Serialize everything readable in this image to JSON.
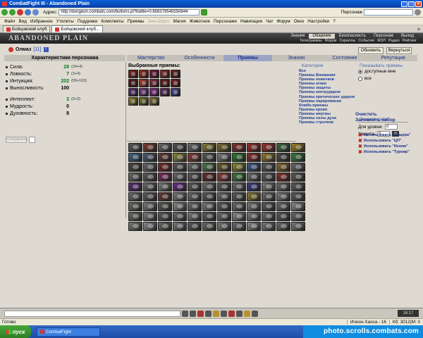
{
  "window": {
    "title": "CombatFight III - Abandoned Plain"
  },
  "address": {
    "label": "Адрес:",
    "url": "http://dungeon.combats.com/buttons.pl?battle=0.658379545550844",
    "search_label": "Персонаж"
  },
  "menu": [
    "Файл",
    "Вид",
    "Избранное",
    "Утилиты",
    "Поддинки",
    "Комплекты",
    "Приемы",
    "Зим.Шфос",
    "Магия",
    "Животное",
    "Персонажи",
    "Навигация",
    "Чат",
    "Форум",
    "Окно",
    "Настройки",
    "?"
  ],
  "tabs": [
    "Бойцовский клуб",
    "Бойцовский клуб..."
  ],
  "game": {
    "logo": "ABANDONED PLAIN",
    "topnav": [
      "Знания",
      "Общение",
      "Безопасность",
      "Персонаж",
      "Выход"
    ],
    "topnav_active": "Общение",
    "subnav": [
      "Телеграммы",
      "Форум",
      "Скриллы",
      "События",
      "ЖЗЛ",
      "Радио",
      "Рейтинг"
    ],
    "character": {
      "name": "Олмаз",
      "level": "[11]",
      "info": "i"
    },
    "buttons": {
      "refresh": "Обновить",
      "back": "Вернуться"
    },
    "char_header": "Характеристики персонажа",
    "section_tabs": [
      "Мастерство",
      "Особенности",
      "Приемы",
      "Знания",
      "Состояние",
      "Репутация"
    ],
    "section_active": "Приемы",
    "stats": [
      {
        "label": "Сила:",
        "value": "28",
        "bonus": "(24+4)",
        "green": true
      },
      {
        "label": "Ловкость:",
        "value": "7",
        "bonus": "(3+4)",
        "green": true
      },
      {
        "label": "Интуиция:",
        "value": "202",
        "bonus": "(99+103)",
        "green": true
      },
      {
        "label": "Выносливость:",
        "value": "100",
        "bonus": "",
        "green": false
      }
    ],
    "stats2": [
      {
        "label": "Интеллект:",
        "value": "3",
        "bonus": "(0+3)",
        "green": true
      },
      {
        "label": "Мудрость:",
        "value": "0",
        "bonus": "",
        "green": false
      },
      {
        "label": "Духовность:",
        "value": "8",
        "bonus": "",
        "green": false
      }
    ],
    "save_label": "Сохранить",
    "selected_title": "Выбранные приемы:",
    "categories_title": "Категории",
    "categories": [
      "Все",
      "Приемы Внимания",
      "Приемы новичков",
      "Приемы атаки",
      "Приемы защиты",
      "Приемы контрударов",
      "Приемы критических ударов",
      "Приемы парирования",
      "Комбо-приемы",
      "Приемы крови",
      "Приемы жертвы",
      "Приемы силы духа",
      "Приемы стрелков"
    ],
    "show_title": "Показывать приемы",
    "show_options": [
      "доступные мне",
      "все"
    ],
    "protect_title": "Защита цели",
    "for_level_label": "Для уровня:",
    "for_level_value": "0",
    "protect_label": "Защита:",
    "protect_value": "0",
    "ok_label": "ok",
    "clear_label": "Очистить",
    "remember_label": "Запомнить набор",
    "use_sets": [
      "Использовать \"Пещера\"",
      "Использовать \"ЦП\"",
      "Использовать \"Излом\"",
      "Использовать \"Турнир\""
    ],
    "clock": "16:17"
  },
  "status": {
    "ready": "Готово",
    "user": "Илион Хаоса - 16",
    "net": "Кб: 3012(М: 0"
  },
  "taskbar": {
    "start": "пуск",
    "task": "CombatFight"
  },
  "watermark": "photo.scrolls.combats.com",
  "colors": {
    "banner": "#2c2c2c",
    "active_tab": "#9ca6c4",
    "link": "#1b2e8a"
  },
  "selected_icons": [
    "#8a1f1f",
    "#a3301a",
    "#7a1a3a",
    "#9a2a2a",
    "#6e2424",
    "#5b1b1b",
    "#b33a2a",
    "#8e2b40",
    "#6a1a1a",
    "#7d2020",
    "#5f2a7a",
    "#7a3a8a",
    "#8a3090",
    "#6a2a6a",
    "#4a4a9a",
    "#9a8a2a",
    "#7a7a2a",
    "#8a7a3a"
  ],
  "all_icons": [
    "#5a5a5a",
    "#7a3a2a",
    "#6a6a6a",
    "#555555",
    "#6b6b6b",
    "#8a7a2a",
    "#7a6a2a",
    "#8a2a2a",
    "#9a2a2a",
    "#a0302a",
    "#3a6a3a",
    "#a08020",
    "#3a6a8a",
    "#4a5a6a",
    "#6a3a3a",
    "#8a8a3a",
    "#8a3a3a",
    "#5a5a5a",
    "#7a7a7a",
    "#2a7a2a",
    "#8a2a2a",
    "#9a7a2a",
    "#4a4a4a",
    "#3a7a3a",
    "#4a4a4a",
    "#6a6a6a",
    "#7a2a2a",
    "#5a5a5a",
    "#6a6a6a",
    "#4a7a4a",
    "#6a5a2a",
    "#8a8a2a",
    "#3a5a8a",
    "#5a5a5a",
    "#8a6a2a",
    "#6a6a6a",
    "#6a6a6a",
    "#5a5a5a",
    "#7a2a5a",
    "#6a6a6a",
    "#5a5a5a",
    "#6a2a2a",
    "#8a3a3a",
    "#3a7a3a",
    "#6a6a6a",
    "#5a5a5a",
    "#8a2a2a",
    "#5a5a5a",
    "#5a2a7a",
    "#6a6a6a",
    "#7a7a7a",
    "#6a2a8a",
    "#5a5a5a",
    "#6a6a6a",
    "#5a5a5a",
    "#6a6a6a",
    "#3a3a8a",
    "#7a7a7a",
    "#6a6a6a",
    "#5a5a5a",
    "#6a6a6a",
    "#5a5a5a",
    "#6a3a3a",
    "#7a7a7a",
    "#6a6a6a",
    "#5a5a5a",
    "#6a6a6a",
    "#5a5a5a",
    "#8a7a2a",
    "#6a6a6a",
    "#7a7a7a",
    "#5a5a5a",
    "#6a6a6a",
    "#7a7a7a",
    "#5a5a5a",
    "#8a8a8a",
    "#6a6a6a",
    "#7a7a7a",
    "#5a5a5a",
    "#6a6a6a",
    "#7a7a7a",
    "#5a5a5a",
    "#6a6a6a",
    "#8a8a8a",
    "#6a6a6a",
    "#7a7a7a",
    "#5a5a5a",
    "#6a6a6a",
    "#7a7a7a",
    "#5a5a5a",
    "#6a6a6a",
    "#8a8a8a",
    "#7a7a7a",
    "#6a6a6a",
    "#5a5a5a",
    "#6a6a6a",
    "#7a7a7a",
    "#8a8a8a",
    "#6a6a6a",
    "#7a7a7a",
    "#5a5a5a",
    "#6a6a6a",
    "#7a7a7a",
    "#6a6a6a",
    "#8a8a8a",
    "#7a7a7a",
    "#6a6a6a",
    "#7a7a7a"
  ]
}
